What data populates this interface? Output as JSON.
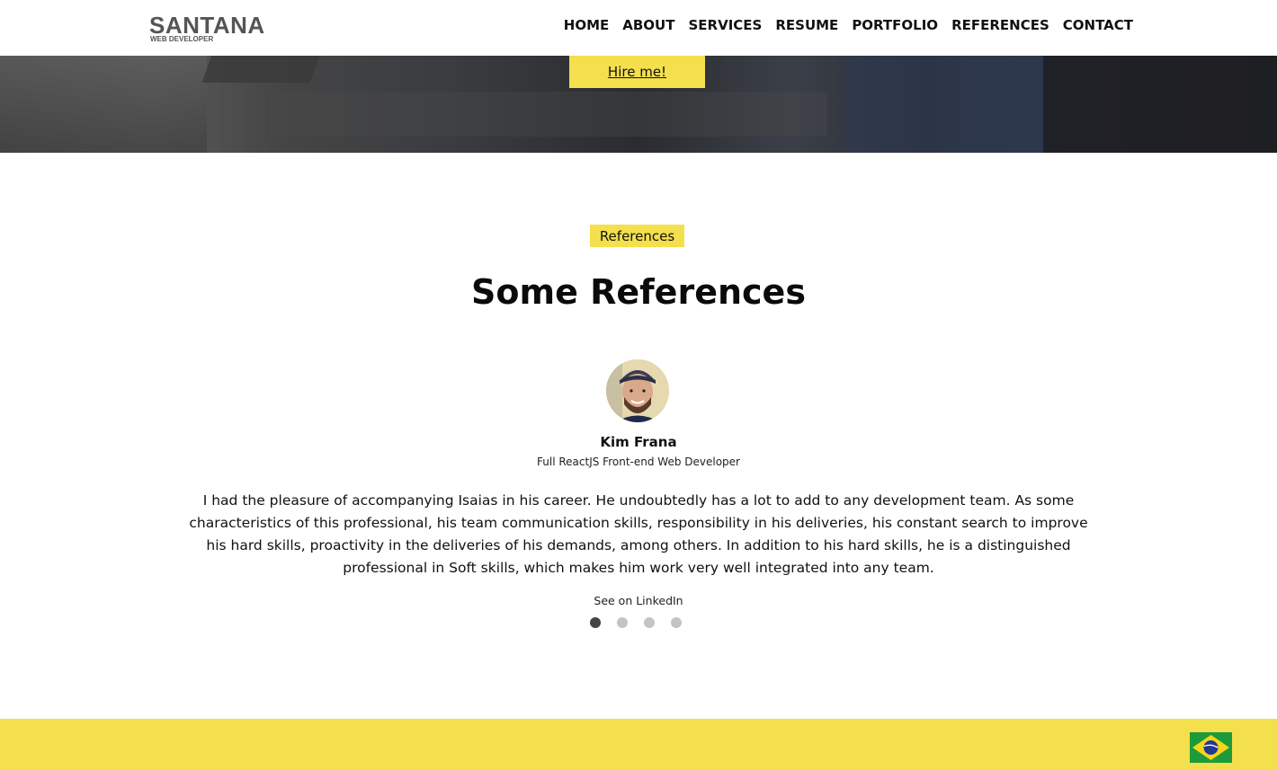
{
  "header": {
    "logo_title": "SANTANA",
    "logo_subtitle": "WEB DEVELOPER",
    "nav": [
      "HOME",
      "ABOUT",
      "SERVICES",
      "RESUME",
      "PORTFOLIO",
      "REFERENCES",
      "CONTACT"
    ]
  },
  "hero": {
    "hire_label": "Hire me!"
  },
  "references": {
    "tag": "References",
    "title": "Some References",
    "current": {
      "name": "Kim Frana",
      "role": "Full ReactJS Front-end Web Developer",
      "quote": "I had the pleasure of accompanying Isaias in his career. He undoubtedly has a lot to add to any development team. As some characteristics of this professional, his team communication skills, responsibility in his deliveries, his constant search to improve his hard skills, proactivity in the deliveries of his demands, among others. In addition to his hard skills, he is a distinguished professional in Soft skills, which makes him work very well integrated into any team.",
      "link_label": "See on LinkedIn"
    },
    "slides_total": 4,
    "active_slide": 1
  },
  "footer": {
    "language_flag": "brazil-flag-icon"
  },
  "colors": {
    "accent": "#f4df4c",
    "text": "#111111",
    "dot_active": "#444444",
    "dot_inactive": "#c4c4c4"
  }
}
